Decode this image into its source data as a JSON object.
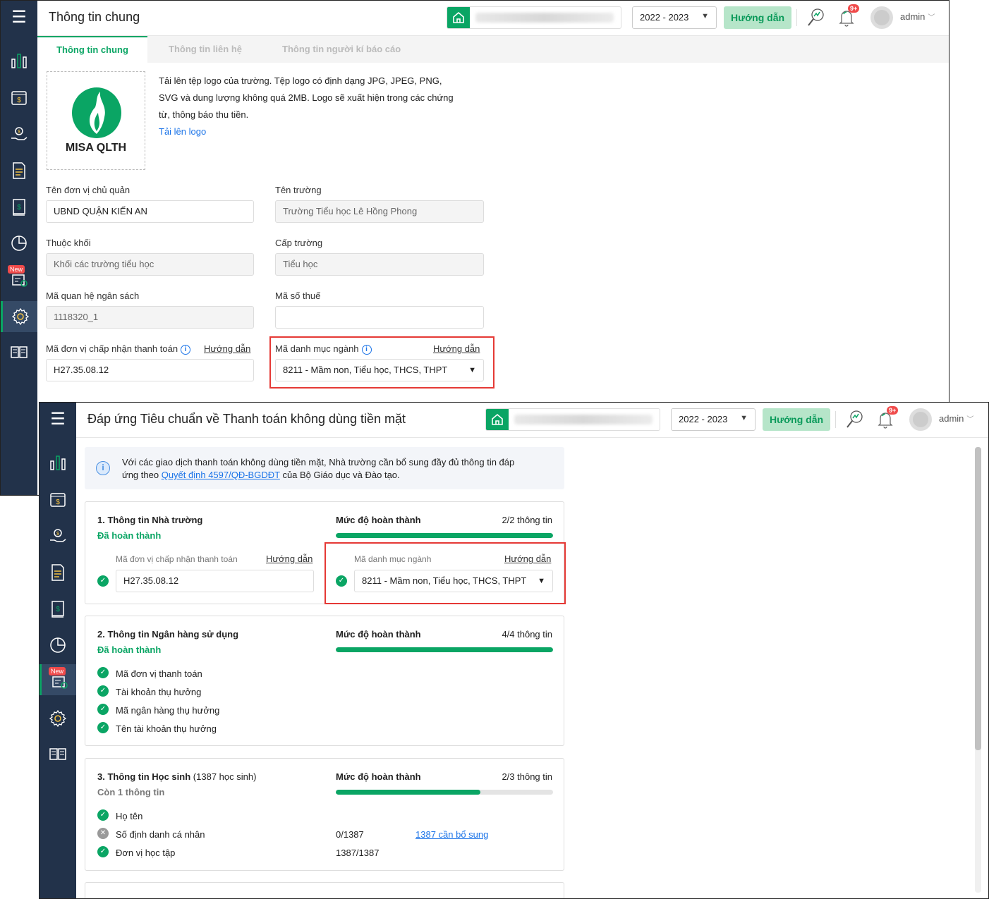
{
  "sidebar": {
    "menu_icon": "☰",
    "items": [
      {
        "icon": "dashboard-chart-icon"
      },
      {
        "icon": "fee-calendar-icon"
      },
      {
        "icon": "payment-hand-icon"
      },
      {
        "icon": "document-icon"
      },
      {
        "icon": "ledger-book-icon"
      },
      {
        "icon": "pie-report-icon"
      },
      {
        "icon": "new-feature-icon",
        "badge": "New"
      },
      {
        "icon": "settings-gear-icon"
      },
      {
        "icon": "guide-book-icon"
      }
    ]
  },
  "header": {
    "year": "2022 - 2023",
    "guide": "Hướng dẫn",
    "notif_badge": "9+",
    "user": "admin"
  },
  "window1": {
    "title": "Thông tin chung",
    "tabs": [
      "Thông tin chung",
      "Thông tin liên hệ",
      "Thông tin người kí báo cáo"
    ],
    "logo_text": "MISA QLTH",
    "logo_desc": "Tải lên tệp logo của trường. Tệp logo có định dạng JPG, JPEG, PNG, SVG và dung lượng không quá 2MB. Logo sẽ xuất hiện trong các chứng từ, thông báo thu tiền.",
    "upload_link": "Tải lên logo",
    "fields": {
      "don_vi_chu_quan": {
        "label": "Tên đơn vị chủ quản",
        "value": "UBND QUẬN KIẾN AN"
      },
      "ten_truong": {
        "label": "Tên trường",
        "value": "Trường Tiểu học Lê Hồng Phong"
      },
      "thuoc_khoi": {
        "label": "Thuộc khối",
        "value": "Khối các trường tiểu học"
      },
      "cap_truong": {
        "label": "Cấp trường",
        "value": "Tiểu học"
      },
      "ma_qhns": {
        "label": "Mã quan hệ ngân sách",
        "value": "1118320_1"
      },
      "ma_so_thue": {
        "label": "Mã số thuế",
        "value": ""
      },
      "ma_dvcntt": {
        "label": "Mã đơn vị chấp nhận thanh toán",
        "value": "H27.35.08.12",
        "guide": "Hướng dẫn"
      },
      "ma_dmn": {
        "label": "Mã danh mục ngành",
        "value": "8211 - Mầm non, Tiểu học, THCS, THPT",
        "guide": "Hướng dẫn"
      }
    }
  },
  "window2": {
    "title": "Đáp ứng Tiêu chuẩn về Thanh toán không dùng tiền mặt",
    "notice_pre": "Với các giao dịch thanh toán không dùng tiền mặt, Nhà trường cần bổ sung đầy đủ thông tin đáp ứng theo ",
    "notice_link": "Quyết định 4597/QĐ-BGDĐT",
    "notice_post": " của Bộ Giáo dục và Đào tạo.",
    "progress_label": "Mức độ hoàn thành",
    "sections": [
      {
        "title": "1. Thông tin Nhà trường",
        "status": "Đã hoàn thành",
        "count": "2/2 thông tin",
        "progress": 100,
        "f1_label": "Mã đơn vị chấp nhận thanh toán",
        "f1_value": "H27.35.08.12",
        "f2_label": "Mã danh mục ngành",
        "f2_value": "8211 - Mầm non, Tiểu học, THCS, THPT",
        "guide": "Hướng dẫn"
      },
      {
        "title": "2. Thông tin Ngân hàng sử dụng",
        "status": "Đã hoàn thành",
        "count": "4/4 thông tin",
        "progress": 100,
        "items": [
          "Mã đơn vị thanh toán",
          "Tài khoản thụ hưởng",
          "Mã ngân hàng thụ hưởng",
          "Tên tài khoản thụ hưởng"
        ]
      },
      {
        "title": "3. Thông tin Học sinh",
        "title_extra": "(1387 học sinh)",
        "status": "Còn 1 thông tin",
        "count": "2/3 thông tin",
        "progress": 66.7,
        "items": [
          {
            "label": "Họ tên",
            "ok": true
          },
          {
            "label": "Số định danh cá nhân",
            "ok": false,
            "value": "0/1387",
            "link": "1387 cần bổ sung"
          },
          {
            "label": "Đơn vị học tập",
            "ok": true,
            "value": "1387/1387"
          }
        ]
      }
    ]
  }
}
